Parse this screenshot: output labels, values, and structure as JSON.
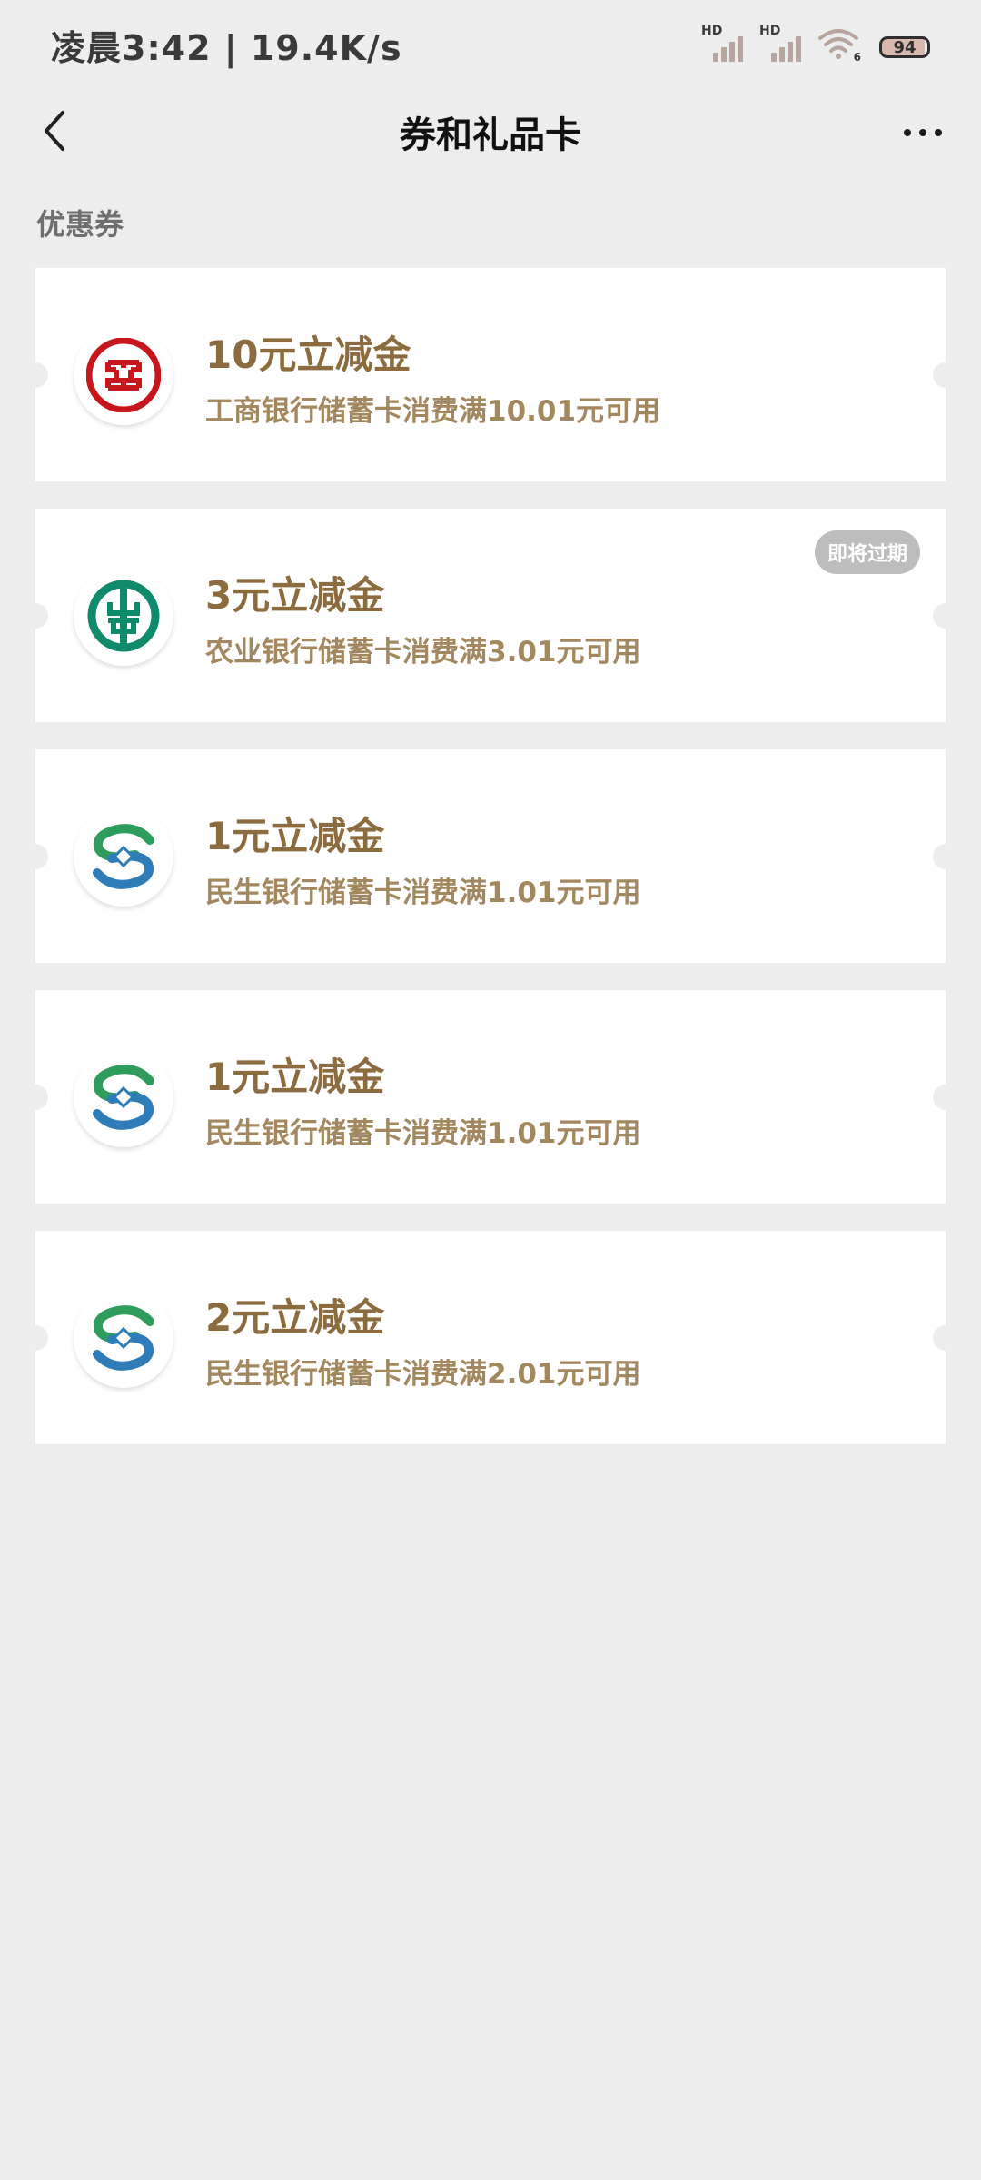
{
  "status_bar": {
    "time": "凌晨3:42 | 19.4K/s",
    "signal1_label": "HD",
    "signal2_label": "HD",
    "wifi_label": "6",
    "battery": "94"
  },
  "nav": {
    "title": "券和礼品卡"
  },
  "section": {
    "title": "优惠券"
  },
  "coupons": [
    {
      "title": "10元立减金",
      "desc": "工商银行储蓄卡消费满10.01元可用",
      "logo": "icbc-logo-icon",
      "badge": ""
    },
    {
      "title": "3元立减金",
      "desc": "农业银行储蓄卡消费满3.01元可用",
      "logo": "abc-logo-icon",
      "badge": "即将过期"
    },
    {
      "title": "1元立减金",
      "desc": "民生银行储蓄卡消费满1.01元可用",
      "logo": "cmbc-logo-icon",
      "badge": ""
    },
    {
      "title": "1元立减金",
      "desc": "民生银行储蓄卡消费满1.01元可用",
      "logo": "cmbc-logo-icon",
      "badge": ""
    },
    {
      "title": "2元立减金",
      "desc": "民生银行储蓄卡消费满2.01元可用",
      "logo": "cmbc-logo-icon",
      "badge": ""
    }
  ],
  "colors": {
    "background": "#EDEDED",
    "coupon_title": "#8C6C3E",
    "coupon_desc": "#A3885F",
    "badge_bg": "#BDBDBD",
    "icbc_red": "#C8161D",
    "abc_green": "#0F8A6B",
    "cmbc_green": "#2E9C5A",
    "cmbc_blue": "#2F7DB8"
  }
}
